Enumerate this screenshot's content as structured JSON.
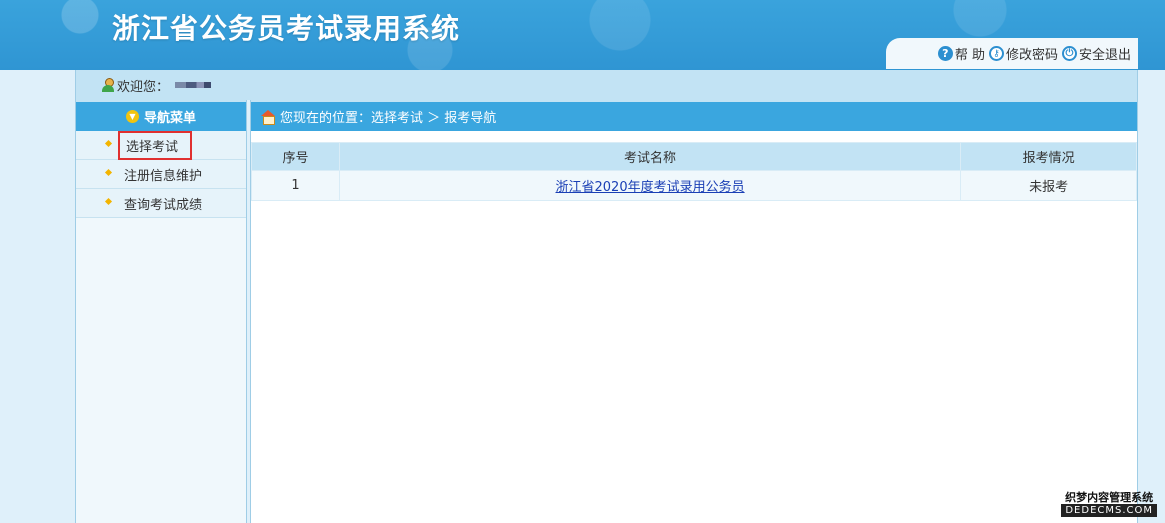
{
  "header": {
    "title": "浙江省公务员考试录用系统",
    "links": [
      {
        "icon": "help-icon",
        "label": "帮 助"
      },
      {
        "icon": "key-icon",
        "label": "修改密码"
      },
      {
        "icon": "power-icon",
        "label": "安全退出"
      }
    ]
  },
  "welcome": {
    "label": "欢迎您："
  },
  "sidebar": {
    "title": "导航菜单",
    "items": [
      {
        "label": "选择考试",
        "active": true
      },
      {
        "label": "注册信息维护"
      },
      {
        "label": "查询考试成绩"
      }
    ]
  },
  "breadcrumb": {
    "text": "您现在的位置：选择考试 ＞ 报考导航"
  },
  "table": {
    "headers": [
      "序号",
      "考试名称",
      "报考情况"
    ],
    "rows": [
      {
        "index": "1",
        "name": "浙江省2020年度考试录用公务员",
        "status": "未报考"
      }
    ]
  },
  "watermark": {
    "line1": "织梦内容管理系统",
    "line2": "DEDECMS.COM"
  },
  "colors": {
    "header": "#3aa3dc",
    "accent": "#3aa6df",
    "highlight": "#e03030"
  }
}
